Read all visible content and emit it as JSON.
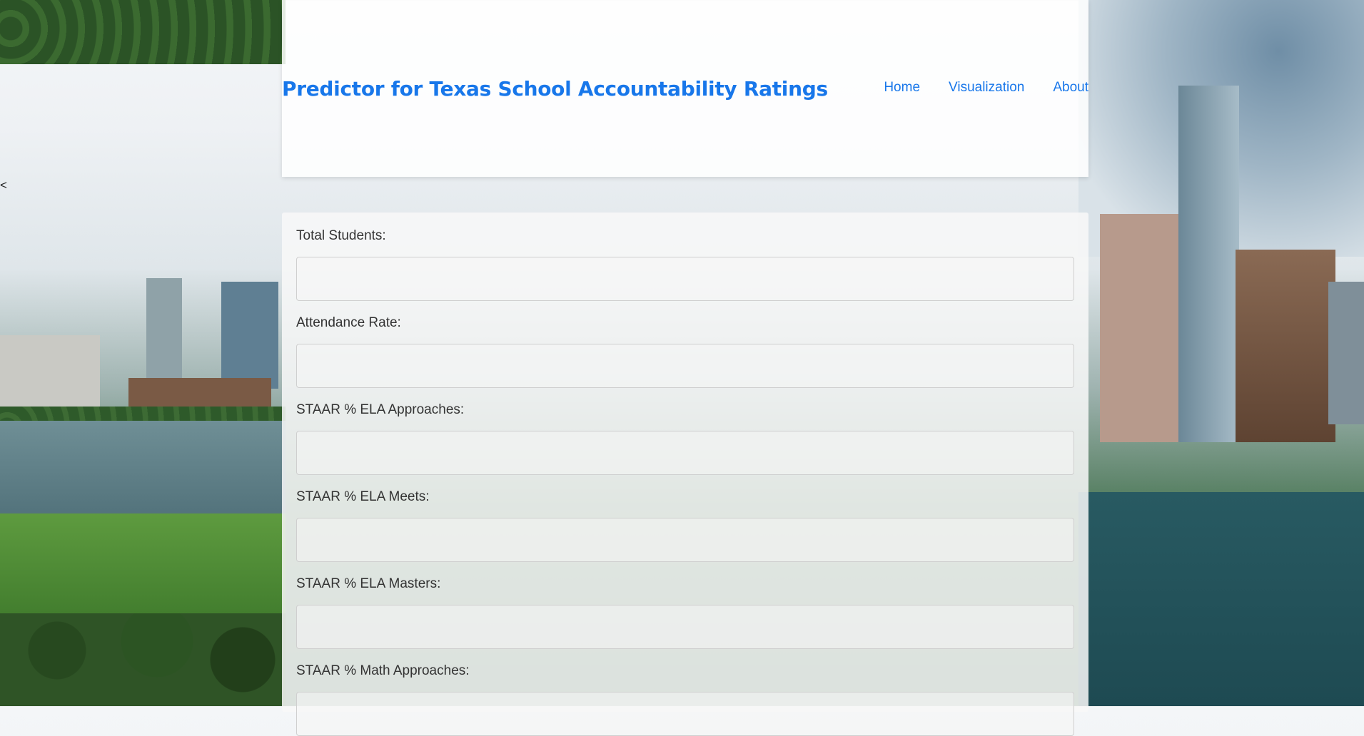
{
  "nav": {
    "back_label": "<",
    "items": [
      {
        "label": "Home"
      },
      {
        "label": "Visualization"
      },
      {
        "label": "About"
      }
    ]
  },
  "header": {
    "title": "Predictor for Texas School Accountability Ratings"
  },
  "form": {
    "fields": [
      {
        "label": "Total Students:",
        "value": ""
      },
      {
        "label": "Attendance Rate:",
        "value": ""
      },
      {
        "label": "STAAR % ELA Approaches:",
        "value": ""
      },
      {
        "label": "STAAR % ELA Meets:",
        "value": ""
      },
      {
        "label": "STAAR % ELA Masters:",
        "value": ""
      },
      {
        "label": "STAAR % Math Approaches:",
        "value": ""
      }
    ]
  },
  "colors": {
    "accent": "#1877ea",
    "label_text": "#333333"
  }
}
